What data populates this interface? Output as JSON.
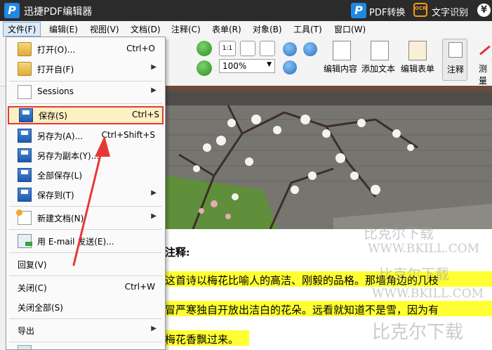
{
  "title_bar": {
    "logo_letter": "P",
    "app_title": "迅捷PDF编辑器",
    "pdf_convert": "PDF转换",
    "ocr_icon_text": "OCR",
    "ocr_label": "文字识别",
    "yen_symbol": "¥"
  },
  "menubar": {
    "items": [
      "文件(F)",
      "编辑(E)",
      "视图(V)",
      "文档(D)",
      "注释(C)",
      "表单(R)",
      "对象(B)",
      "工具(T)",
      "窗口(W)"
    ]
  },
  "toolbar": {
    "zoom_value": "100%",
    "edit_content": "编辑内容",
    "add_text": "添加文本",
    "edit_form": "编辑表单",
    "annotate": "注释",
    "measure": "测量",
    "page_fit_label": "1:1"
  },
  "file_menu": {
    "open": {
      "label": "打开(O)...",
      "shortcut": "Ctrl+O"
    },
    "open_from": {
      "label": "打开自(F)"
    },
    "sessions": {
      "label": "Sessions"
    },
    "save": {
      "label": "保存(S)",
      "shortcut": "Ctrl+S"
    },
    "save_as": {
      "label": "另存为(A)...",
      "shortcut": "Ctrl+Shift+S"
    },
    "save_copy": {
      "label": "另存为副本(Y)..."
    },
    "save_all": {
      "label": "全部保存(L)"
    },
    "save_to": {
      "label": "保存到(T)"
    },
    "new_doc": {
      "label": "新建文档(N)"
    },
    "email": {
      "label": "用 E-mail 发送(E)..."
    },
    "revert": {
      "label": "回复(V)"
    },
    "close": {
      "label": "关闭(C)",
      "shortcut": "Ctrl+W"
    },
    "close_all": {
      "label": "关闭全部(S)"
    },
    "export": {
      "label": "导出"
    },
    "arrow": "▶"
  },
  "document": {
    "heading": "注释:",
    "line1": "这首诗以梅花比喻人的高洁、刚毅的品格。那墙角边的几枝",
    "line2": "冒严寒独自开放出洁白的花朵。远看就知道不是雪，因为有",
    "line3": "梅花香飘过来。"
  },
  "watermark": {
    "cn_top": "比克尔下载",
    "url1": "WWW.BKILL.COM",
    "cn_mid": "比克尔下载",
    "url2": "WWW.BKILL.COM",
    "cn_bottom": "比克尔下载"
  },
  "colors": {
    "title_bg": "#2b2b2b",
    "highlight": "#ffff33",
    "annotation_red": "#e53935",
    "logo_blue": "#1e88e5"
  }
}
